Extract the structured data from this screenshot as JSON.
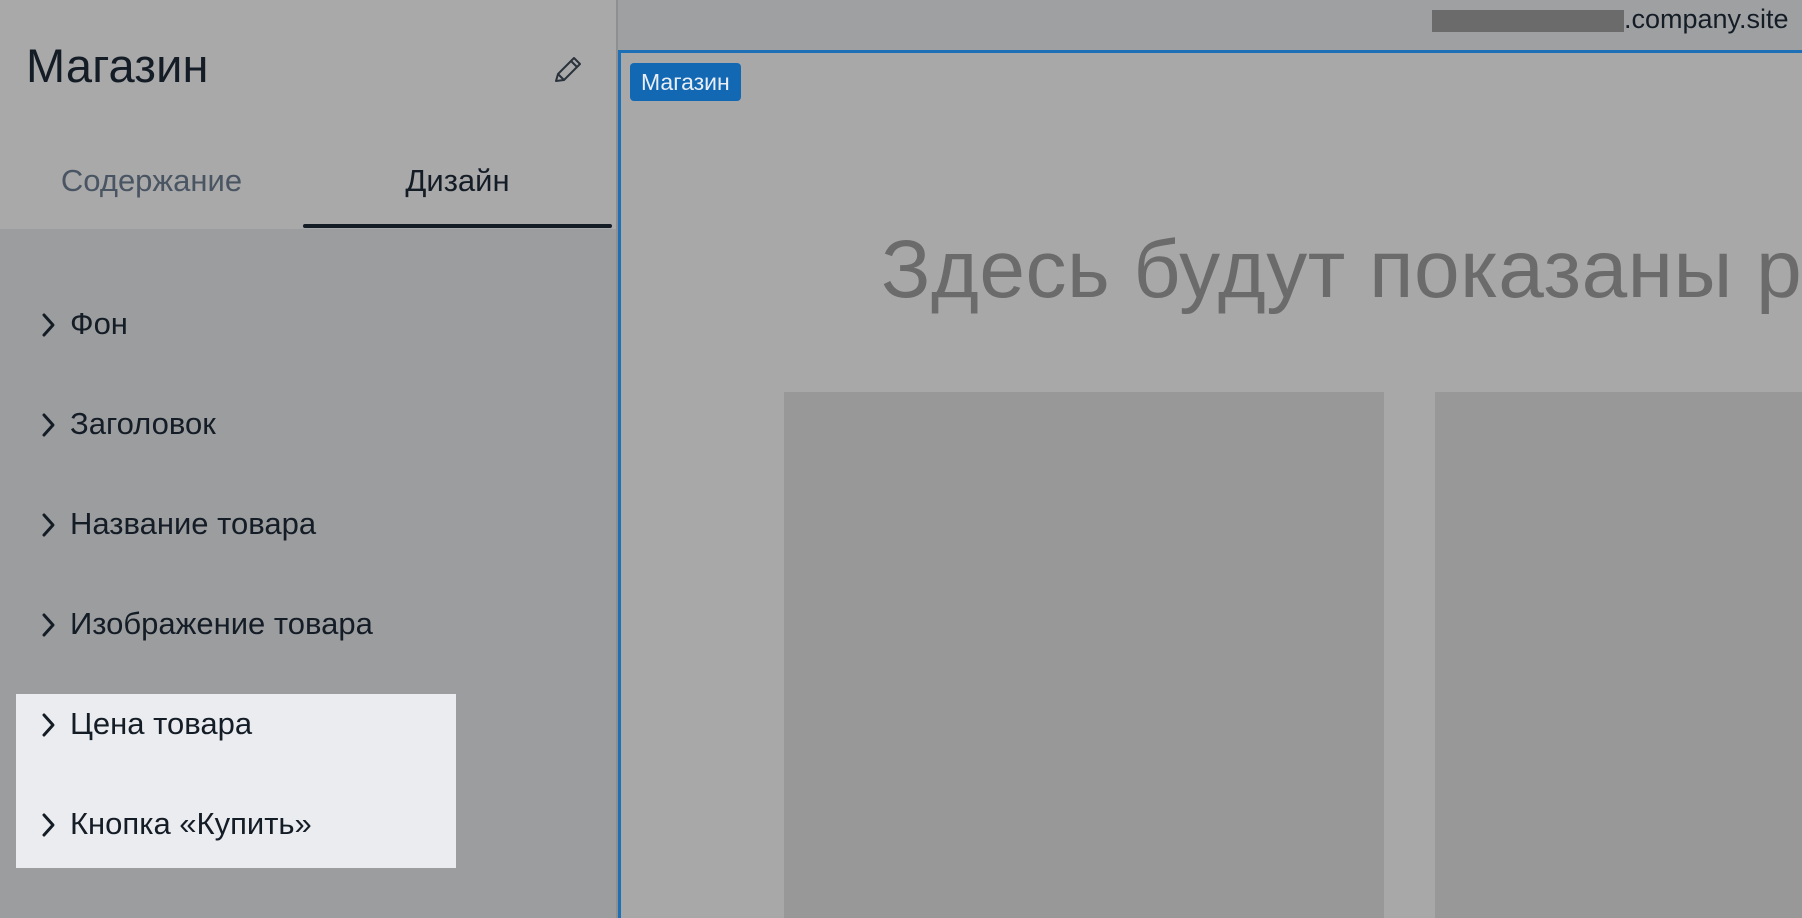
{
  "panel": {
    "title": "Магазин",
    "tabs": [
      {
        "label": "Содержание",
        "active": false
      },
      {
        "label": "Дизайн",
        "active": true
      }
    ],
    "sections": [
      {
        "label": "Фон"
      },
      {
        "label": "Заголовок"
      },
      {
        "label": "Название товара"
      },
      {
        "label": "Изображение товара"
      },
      {
        "label": "Цена товара",
        "highlighted": true
      },
      {
        "label": "Кнопка «Купить»",
        "highlighted": true
      }
    ]
  },
  "preview": {
    "url_suffix": ".company.site",
    "block_badge": "Магазин",
    "heading": "Здесь будут показаны ре"
  },
  "colors": {
    "accent": "#1368b4",
    "highlight": "#ebecf0",
    "text_dark": "#141c26"
  },
  "icons": {
    "edit": "pencil-icon",
    "expand": "chevron-right-icon"
  }
}
